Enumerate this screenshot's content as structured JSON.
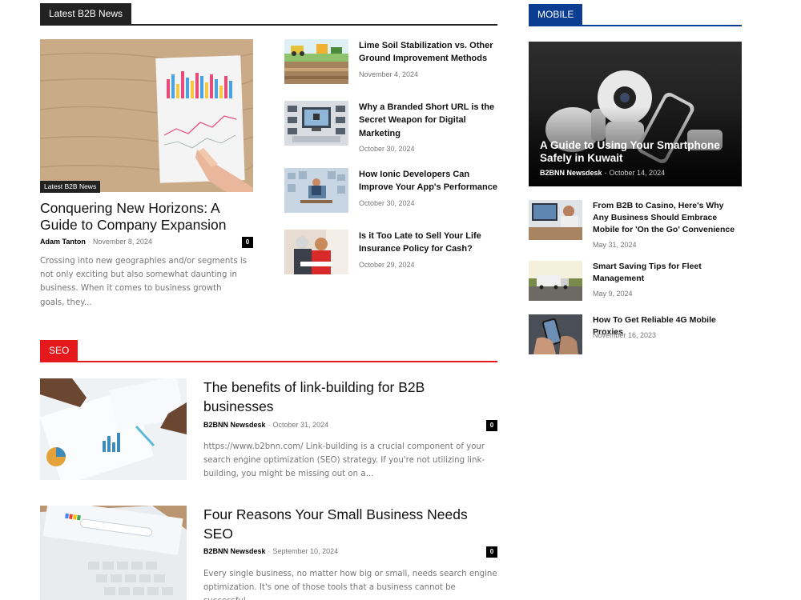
{
  "sections": {
    "latest": {
      "label": "Latest B2B News",
      "color": "#222222"
    },
    "mobile": {
      "label": "MOBILE",
      "color": "#0b3d91"
    },
    "seo": {
      "label": "SEO",
      "color": "#e5181c"
    }
  },
  "featured": {
    "category": "Latest B2B News",
    "title": "Conquering New Horizons: A Guide to Company Expansion",
    "author": "Adam Tanton",
    "date": "November 8, 2024",
    "comments": "0",
    "excerpt": "Crossing into new geographies and/or segments is not only exciting but also somewhat daunting in business. When it comes to business growth goals, they..."
  },
  "latest_list": [
    {
      "title": "Lime Soil Stabilization vs. Other Ground Improvement Methods",
      "date": "November 4, 2024"
    },
    {
      "title": "Why a Branded Short URL is the Secret Weapon for Digital Marketing",
      "date": "October 30, 2024"
    },
    {
      "title": "How Ionic Developers Can Improve Your App's Performance",
      "date": "October 30, 2024"
    },
    {
      "title": "Is it Too Late to Sell Your Life Insurance Policy for Cash?",
      "date": "October 29, 2024"
    }
  ],
  "seo_posts": [
    {
      "title": "The benefits of link-building for B2B businesses",
      "author": "B2BNN Newsdesk",
      "date": "October 31, 2024",
      "comments": "0",
      "excerpt": "https://www.b2bnn.com/ Link-building is a crucial component of your search engine optimization (SEO) strategy. If you're not utilizing link-building, you might be missing out on a..."
    },
    {
      "title": "Four Reasons Your Small Business Needs SEO",
      "author": "B2BNN Newsdesk",
      "date": "September 10, 2024",
      "comments": "0",
      "excerpt": "Every single business, no matter how big or small, needs search engine optimization. It's one of those tools that a business cannot be successful..."
    }
  ],
  "mobile_featured": {
    "title": "A Guide to Using Your Smartphone Safely in Kuwait",
    "author": "B2BNN Newsdesk",
    "date": "October 14, 2024"
  },
  "mobile_list": [
    {
      "title": "From B2B to Casino, Here's Why Any Business Should Embrace Mobile for 'On the Go' Convenience",
      "date": "May 31, 2024"
    },
    {
      "title": "Smart Saving Tips for Fleet Management",
      "date": "May 9, 2024"
    },
    {
      "title": "How To Get Reliable 4G Mobile Proxies",
      "date": "November 16, 2023"
    }
  ]
}
